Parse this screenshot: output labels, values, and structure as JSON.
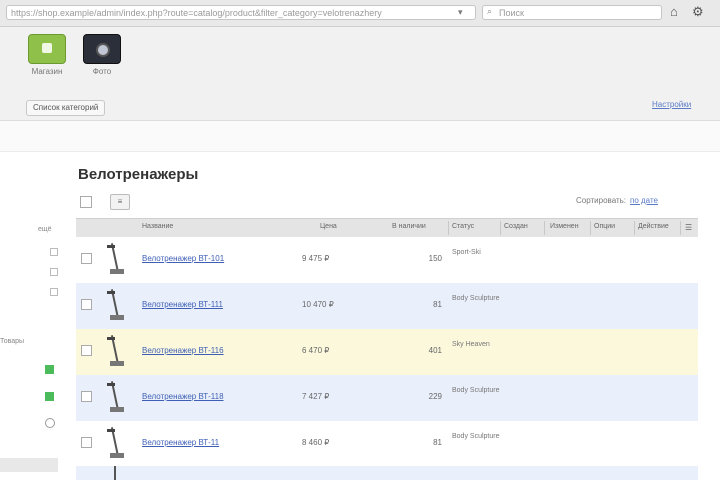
{
  "browser": {
    "url": "https://shop.example/admin/index.php?route=catalog/product&filter_category=velotrenazhery",
    "search_placeholder": "Поиск",
    "toolbar_icons": [
      "home-icon",
      "gear-icon"
    ]
  },
  "panel": {
    "apps": [
      {
        "label": "Магазин",
        "icon": "shopping-basket-icon"
      },
      {
        "label": "Фото",
        "icon": "camera-icon"
      }
    ],
    "button_label": "Список категорий",
    "link_label": "Настройки"
  },
  "sidebar": {
    "items": [
      "ещё",
      "",
      "",
      ""
    ],
    "label": "Товары"
  },
  "main": {
    "title": "Велотренажеры",
    "sort_label": "Сортировать:",
    "sort_value": "по дате",
    "columns": [
      "Название",
      "Цена",
      "В наличии",
      "Статус",
      "Создан",
      "Изменен",
      "Опции",
      "Действие"
    ],
    "rows": [
      {
        "name": "Велотренажер ВТ-101",
        "price": "9 475 ₽",
        "qty": "150",
        "status": "Sport-Ski"
      },
      {
        "name": "Велотренажер ВТ-111",
        "price": "10 470 ₽",
        "qty": "81",
        "status": "Body Sculpture"
      },
      {
        "name": "Велотренажер ВТ-116",
        "price": "6 470 ₽",
        "qty": "401",
        "status": "Sky Heaven"
      },
      {
        "name": "Велотренажер ВТ-118",
        "price": "7 427 ₽",
        "qty": "229",
        "status": "Body Sculpture"
      },
      {
        "name": "Велотренажер ВТ-11",
        "price": "8 460 ₽",
        "qty": "81",
        "status": "Body Sculpture"
      }
    ],
    "row_colors": [
      "#ffffff",
      "#eaf0fb",
      "#fbf8dc",
      "#eaf0fb",
      "#ffffff"
    ]
  }
}
